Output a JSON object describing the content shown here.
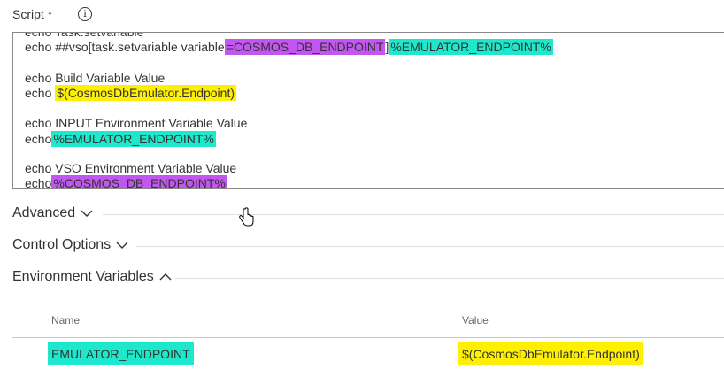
{
  "field": {
    "label": "Script",
    "required_mark": "*",
    "info_glyph": "i"
  },
  "script_lines": {
    "top_partial": "echo Task.setvariable",
    "line1_prefix": "echo ##vso[task.setvariable variable",
    "line1_hl1": "=COSMOS_DB_ENDPOINT",
    "line1_sep": "]",
    "line1_hl2": "%EMULATOR_ENDPOINT%",
    "line2": "echo Build Variable Value",
    "line3_prefix": "echo ",
    "line3_hl": "$(CosmosDbEmulator.Endpoint)",
    "line4": "echo INPUT Environment Variable Value",
    "line5_prefix": "echo",
    "line5_hl": "%EMULATOR_ENDPOINT%",
    "line6": "echo VSO Environment Variable Value",
    "line7_prefix": "echo",
    "line7_hl": "%COSMOS_DB_ENDPOINT%"
  },
  "sections": {
    "advanced": "Advanced",
    "control_options": "Control Options",
    "environment_variables": "Environment Variables"
  },
  "env_table": {
    "columns": [
      "Name",
      "Value"
    ],
    "rows": [
      {
        "name": "EMULATOR_ENDPOINT",
        "value": "$(CosmosDbEmulator.Endpoint)"
      }
    ]
  },
  "colors": {
    "purple": "#c356f0",
    "cyan": "#1ee8cc",
    "yellow": "#ffef00",
    "required": "#d13438"
  },
  "icons": [
    "info-icon",
    "chevron-down-icon",
    "chevron-up-icon",
    "hand-cursor-icon"
  ]
}
